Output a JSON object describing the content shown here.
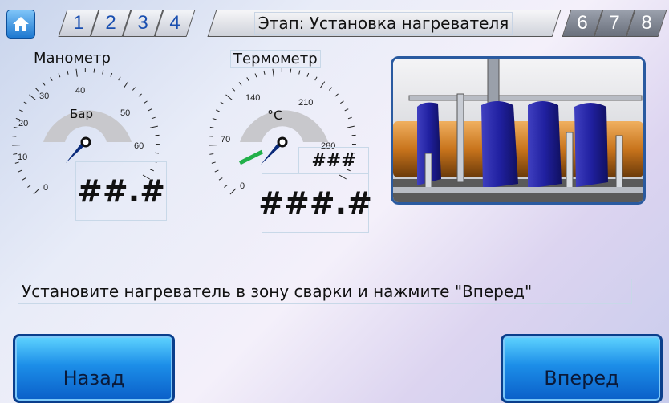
{
  "header": {
    "steps_left": [
      "1",
      "2",
      "3",
      "4"
    ],
    "stage_title": "Этап: Установка нагревателя",
    "steps_right": [
      "6",
      "7",
      "8"
    ]
  },
  "pressure_gauge": {
    "title": "Манометр",
    "unit": "Бар",
    "ticks": [
      "0",
      "10",
      "20",
      "30",
      "40",
      "50",
      "60"
    ],
    "readout": "##.#"
  },
  "temperature_gauge": {
    "title": "Термометр",
    "unit": "°C",
    "ticks": [
      "0",
      "70",
      "140",
      "210",
      "280"
    ],
    "setpoint_readout": "###",
    "readout": "###.#"
  },
  "message": "Установите нагреватель в зону сварки и нажмите \"Вперед\"",
  "buttons": {
    "back": "Назад",
    "forward": "Вперед"
  },
  "colors": {
    "accent_blue": "#1c8ee8",
    "needle": "#0a2a7a",
    "setpoint_green": "#22b04a"
  }
}
